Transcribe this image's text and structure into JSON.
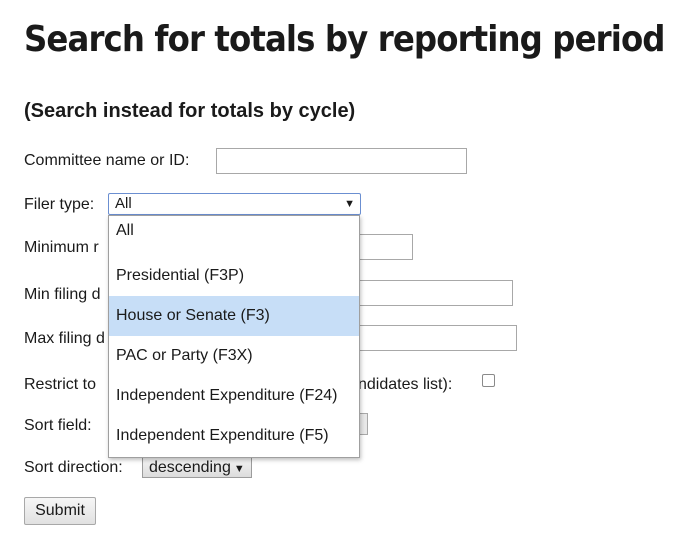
{
  "page": {
    "title": "Search for totals by reporting period",
    "subtitle": "(Search instead for totals by cycle)"
  },
  "form": {
    "committee_label": "Committee name or ID:",
    "committee_value": "",
    "filer_type_label": "Filer type:",
    "filer_type_value": "All",
    "minimum_label": "Minimum r",
    "min_filing_label": "Min filing d",
    "max_filing_label": "Max filing d",
    "restrict_label_start": "Restrict to",
    "restrict_label_end": "ndidates list):",
    "sort_field_label": "Sort field:",
    "sort_direction_label": "Sort direction:",
    "sort_direction_value": "descending",
    "submit_label": "Submit"
  },
  "dropdown": {
    "options": [
      {
        "label": "All",
        "highlighted": false
      },
      {
        "label": "Presidential (F3P)",
        "highlighted": false
      },
      {
        "label": "House or Senate (F3)",
        "highlighted": true
      },
      {
        "label": "PAC or Party (F3X)",
        "highlighted": false
      },
      {
        "label": "Independent Expenditure (F24)",
        "highlighted": false
      },
      {
        "label": "Independent Expenditure (F5)",
        "highlighted": false
      }
    ]
  },
  "colors": {
    "highlight": "#c7def7",
    "focus_border": "#6b8fd1"
  }
}
